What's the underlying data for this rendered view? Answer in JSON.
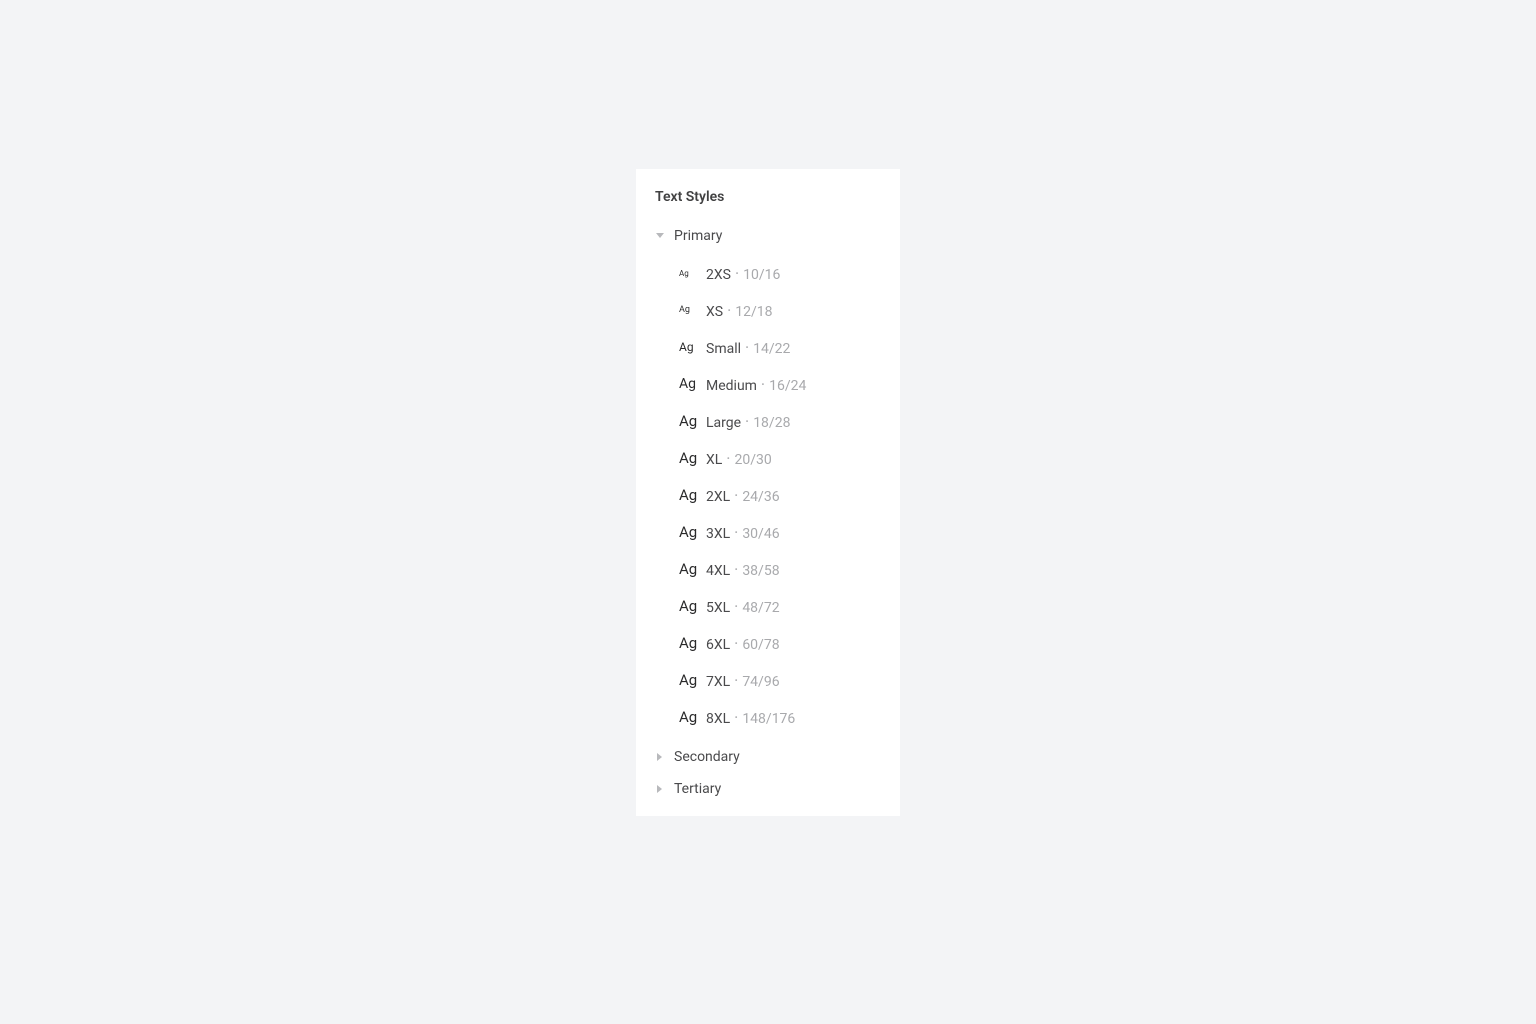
{
  "panel": {
    "title": "Text Styles"
  },
  "categories": [
    {
      "label": "Primary",
      "expanded": true,
      "styles": [
        {
          "ag_class": "ag-10",
          "name": "2XS",
          "dims": "10/16"
        },
        {
          "ag_class": "ag-12",
          "name": "XS",
          "dims": "12/18"
        },
        {
          "ag_class": "ag-14",
          "name": "Small",
          "dims": "14/22"
        },
        {
          "ag_class": "ag-16",
          "name": "Medium",
          "dims": "16/24"
        },
        {
          "ag_class": "ag-18",
          "name": "Large",
          "dims": "18/28"
        },
        {
          "ag_class": "ag-20",
          "name": "XL",
          "dims": "20/30"
        },
        {
          "ag_class": "ag-24",
          "name": "2XL",
          "dims": "24/36"
        },
        {
          "ag_class": "ag-30",
          "name": "3XL",
          "dims": "30/46"
        },
        {
          "ag_class": "ag-38",
          "name": "4XL",
          "dims": "38/58"
        },
        {
          "ag_class": "ag-48",
          "name": "5XL",
          "dims": "48/72"
        },
        {
          "ag_class": "ag-60",
          "name": "6XL",
          "dims": "60/78"
        },
        {
          "ag_class": "ag-74",
          "name": "7XL",
          "dims": "74/96"
        },
        {
          "ag_class": "ag-148",
          "name": "8XL",
          "dims": "148/176"
        }
      ]
    },
    {
      "label": "Secondary",
      "expanded": false
    },
    {
      "label": "Tertiary",
      "expanded": false
    }
  ],
  "ag_prefix": "Ag",
  "separator": " · "
}
